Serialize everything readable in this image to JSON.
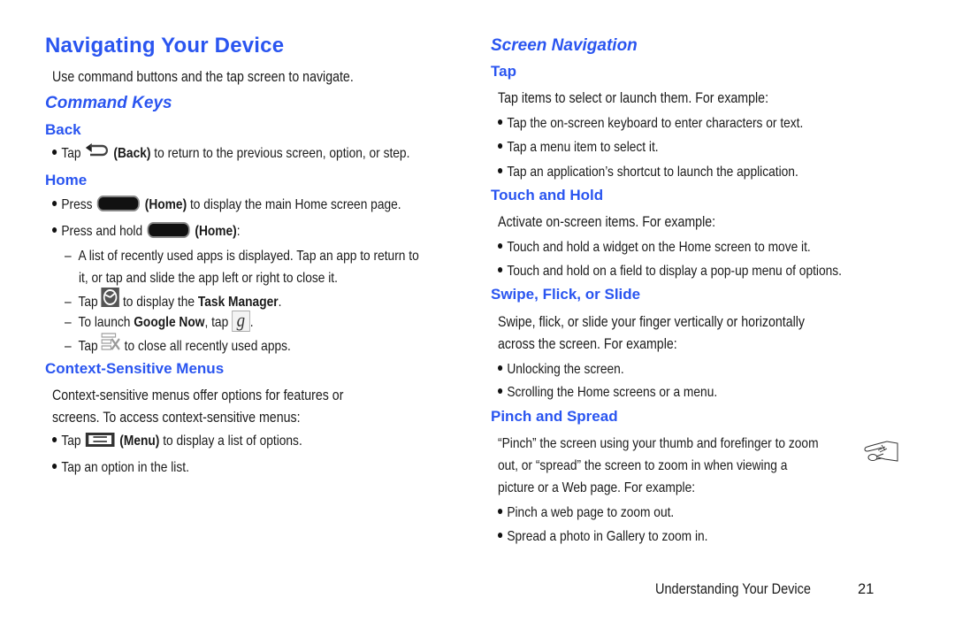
{
  "left": {
    "title": "Navigating Your Device",
    "intro": "Use command buttons and the tap screen to navigate.",
    "command_keys": {
      "heading": "Command Keys",
      "back": {
        "heading": "Back",
        "bullet": {
          "pre": "Tap",
          "label": "(Back)",
          "post": " to return to the previous screen, option, or step.",
          "icon": "back-arrow-icon"
        }
      },
      "home": {
        "heading": "Home",
        "bullet1": {
          "pre": "Press",
          "label": "(Home)",
          "post": " to display the main Home screen page.",
          "icon": "home-key-icon"
        },
        "bullet2": {
          "pre": "Press and hold",
          "label": "(Home)",
          "post": ":",
          "icon": "home-key-icon"
        },
        "sub1_line1": "A list of recently used apps is displayed. Tap an app to return to",
        "sub1_line2": "it, or tap and slide the app left or right to close it.",
        "sub2": {
          "pre": "Tap",
          "post_pre": " to display the ",
          "bold": "Task Manager",
          "post": ".",
          "icon": "task-manager-icon"
        },
        "sub3": {
          "pre": "To launch ",
          "bold": "Google Now",
          "mid": ", tap",
          "post": ".",
          "icon": "google-now-icon",
          "icon_glyph": "g"
        },
        "sub4": {
          "pre": "Tap",
          "post": " to close all recently used apps.",
          "icon": "close-all-apps-icon"
        }
      }
    },
    "context_menus": {
      "heading": "Context-Sensitive Menus",
      "para_line1": "Context-sensitive menus offer options for features or",
      "para_line2": "screens. To access context-sensitive menus:",
      "bullet1": {
        "pre": "Tap",
        "label": "(Menu)",
        "post": " to display a list of options.",
        "icon": "menu-key-icon"
      },
      "bullet2": "Tap an option in the list."
    }
  },
  "right": {
    "heading": "Screen Navigation",
    "tap": {
      "heading": "Tap",
      "intro": "Tap items to select or launch them. For example:",
      "bullets": [
        "Tap the on-screen keyboard to enter characters or text.",
        "Tap a menu item to select it.",
        "Tap an application’s shortcut to launch the application."
      ]
    },
    "touch_hold": {
      "heading": "Touch and Hold",
      "intro": "Activate on-screen items. For example:",
      "bullets": [
        "Touch and hold a widget on the Home screen to move it.",
        "Touch and hold on a field to display a pop-up menu of options."
      ]
    },
    "swipe": {
      "heading": "Swipe, Flick, or Slide",
      "intro_line1": "Swipe, flick, or slide your finger vertically or horizontally",
      "intro_line2": "across the screen. For example:",
      "bullets": [
        "Unlocking the screen.",
        "Scrolling the Home screens or a menu."
      ]
    },
    "pinch": {
      "heading": "Pinch and Spread",
      "intro_line1": "“Pinch” the screen using your thumb and forefinger to zoom",
      "intro_line2": "out, or “spread” the screen to zoom in when viewing a",
      "intro_line3": "picture or a Web page. For example:",
      "icon": "pinch-gesture-icon",
      "bullets": [
        "Pinch a web page to zoom out.",
        "Spread a photo in Gallery to zoom in."
      ]
    }
  },
  "footer": {
    "section": "Understanding Your Device",
    "page": "21"
  },
  "colors": {
    "heading_blue": "#2a55f0",
    "text": "#1a1a1a"
  }
}
